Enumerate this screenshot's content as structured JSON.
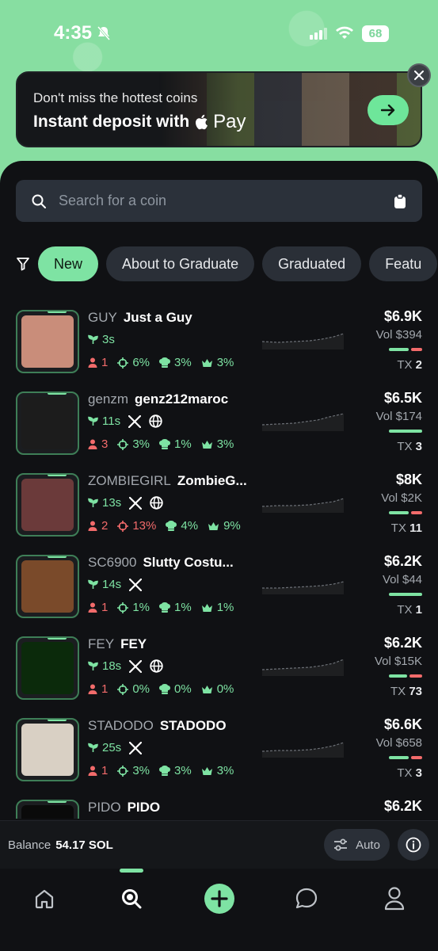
{
  "status_bar": {
    "time": "4:35",
    "battery": "68"
  },
  "promo": {
    "line1": "Don't miss the hottest coins",
    "line2": "Instant deposit with",
    "pay_label": "Pay"
  },
  "search": {
    "placeholder": "Search for a coin"
  },
  "tabs": [
    {
      "label": "New",
      "active": true
    },
    {
      "label": "About to Graduate",
      "active": false
    },
    {
      "label": "Graduated",
      "active": false
    },
    {
      "label": "Featu",
      "active": false
    }
  ],
  "coins": [
    {
      "ticker": "GUY",
      "name": "Just a Guy",
      "age": "3s",
      "socials": [],
      "holders": "1",
      "pct1": "6%",
      "pct1_red": false,
      "pct2": "3%",
      "pct3": "3%",
      "mcap": "$6.9K",
      "vol": "Vol $394",
      "buy_frac": 0.6,
      "tx": "2",
      "avatar_color": "#c98d7a"
    },
    {
      "ticker": "genzm",
      "name": "genz212maroc",
      "age": "11s",
      "socials": [
        "x-icon",
        "globe-icon"
      ],
      "holders": "3",
      "pct1": "3%",
      "pct1_red": false,
      "pct2": "1%",
      "pct3": "3%",
      "mcap": "$6.5K",
      "vol": "Vol $174",
      "buy_frac": 1.0,
      "tx": "3",
      "avatar_color": "#1c1c1c"
    },
    {
      "ticker": "ZOMBIEGIRL",
      "name": "ZombieG...",
      "age": "13s",
      "socials": [
        "x-icon",
        "globe-icon"
      ],
      "holders": "2",
      "pct1": "13%",
      "pct1_red": true,
      "pct2": "4%",
      "pct3": "9%",
      "mcap": "$8K",
      "vol": "Vol $2K",
      "buy_frac": 0.6,
      "tx": "11",
      "avatar_color": "#6b3a3a"
    },
    {
      "ticker": "SC6900",
      "name": "Slutty Costu...",
      "age": "14s",
      "socials": [
        "x-icon"
      ],
      "holders": "1",
      "pct1": "1%",
      "pct1_red": false,
      "pct2": "1%",
      "pct3": "1%",
      "mcap": "$6.2K",
      "vol": "Vol $44",
      "buy_frac": 1.0,
      "tx": "1",
      "avatar_color": "#7a4a2a"
    },
    {
      "ticker": "FEY",
      "name": "FEY",
      "age": "18s",
      "socials": [
        "x-icon",
        "globe-icon"
      ],
      "holders": "1",
      "pct1": "0%",
      "pct1_red": false,
      "pct2": "0%",
      "pct3": "0%",
      "mcap": "$6.2K",
      "vol": "Vol $15K",
      "buy_frac": 0.55,
      "tx": "73",
      "avatar_color": "#0b2a0b"
    },
    {
      "ticker": "STADODO",
      "name": "STADODO",
      "age": "25s",
      "socials": [
        "x-icon"
      ],
      "holders": "1",
      "pct1": "3%",
      "pct1_red": false,
      "pct2": "3%",
      "pct3": "3%",
      "mcap": "$6.6K",
      "vol": "Vol $658",
      "buy_frac": 0.6,
      "tx": "3",
      "avatar_color": "#d9d0c4"
    },
    {
      "ticker": "PIDO",
      "name": "PIDO",
      "age": "",
      "socials": [],
      "holders": "",
      "pct1": "",
      "pct1_red": false,
      "pct2": "",
      "pct3": "",
      "mcap": "$6.2K",
      "vol": "",
      "buy_frac": 0,
      "tx": "",
      "avatar_color": "#0a0a0a"
    }
  ],
  "balance": {
    "label": "Balance",
    "value": "54.17 SOL",
    "auto_label": "Auto"
  },
  "nav": [
    "home-icon",
    "search-icon",
    "create-icon",
    "chat-icon",
    "profile-icon"
  ],
  "colors": {
    "accent": "#7ee3a3",
    "danger": "#f26b6b",
    "bg": "#101114"
  }
}
